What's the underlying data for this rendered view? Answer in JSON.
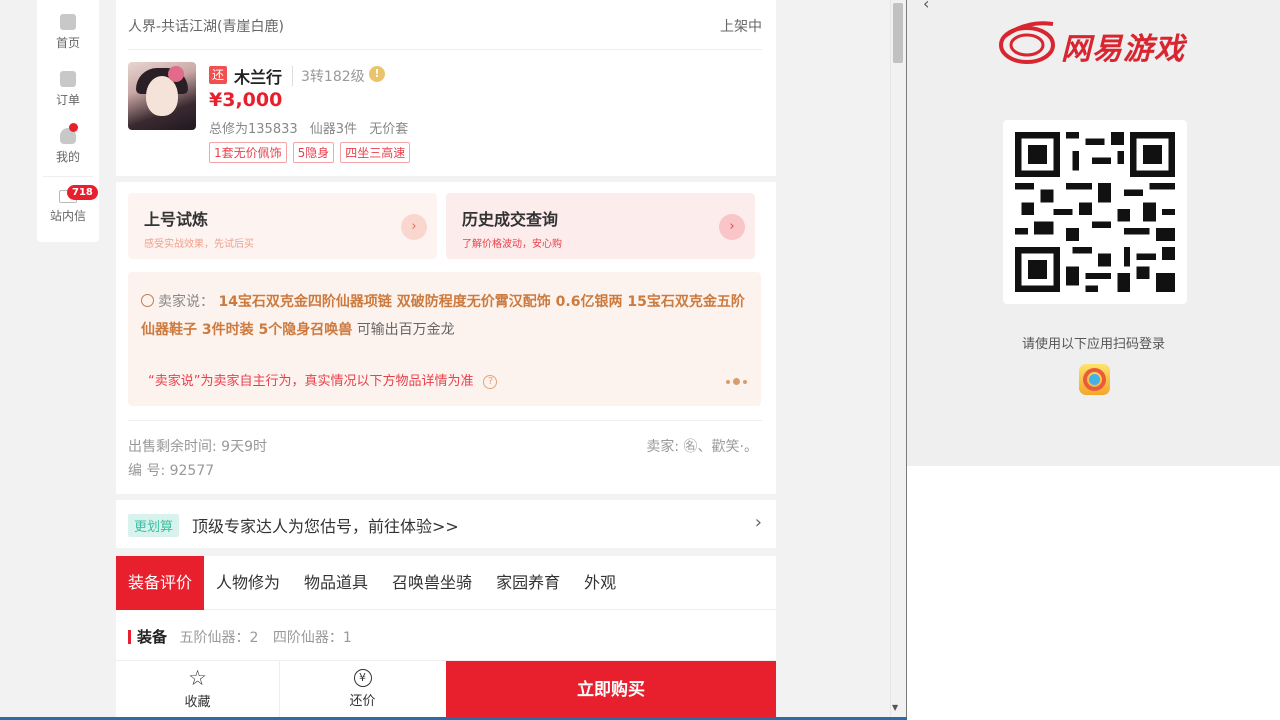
{
  "sidenav": {
    "items": [
      {
        "label": "首页",
        "icon": "home-icon"
      },
      {
        "label": "订单",
        "icon": "order-icon"
      },
      {
        "label": "我的",
        "icon": "user-icon"
      },
      {
        "label": "站内信",
        "icon": "mail-icon"
      }
    ],
    "message_count": "718"
  },
  "listing": {
    "server": "人界-共话江湖(青崖白鹿)",
    "status": "上架中",
    "tag": "还",
    "name": "木兰行",
    "level": "3转182级",
    "price": "¥3,000",
    "attrs": [
      "总修为135833",
      "仙器3件",
      "无价套"
    ],
    "chips": [
      "1套无价佩饰",
      "5隐身",
      "四坐三高速"
    ]
  },
  "tiles": [
    {
      "title": "上号试炼",
      "subtitle": "感受实战效果，先试后买"
    },
    {
      "title": "历史成交查询",
      "subtitle": "了解价格波动，安心购"
    }
  ],
  "seller_says": {
    "label": "卖家说：",
    "highlight": "14宝石双克金四阶仙器项链 双破防程度无价霄汉配饰 0.6亿银两 15宝石双克金五阶仙器鞋子 3件时装 5个隐身召唤兽",
    "tail": "可输出百万金龙",
    "note": "“卖家说”为卖家自主行为，真实情况以下方物品详情为准"
  },
  "meta": {
    "remaining": "出售剩余时间: 9天9时",
    "serial": "编 号: 92577",
    "seller": "卖家: ㊔、歡笑·。"
  },
  "evaluation": {
    "tag": "更划算",
    "text": "顶级专家达人为您估号，前往体验>>"
  },
  "tabs": [
    "装备评价",
    "人物修为",
    "物品道具",
    "召唤兽坐骑",
    "家园养育",
    "外观"
  ],
  "equip_section": {
    "title": "装备",
    "tiers": [
      "五阶仙器：2",
      "四阶仙器：1"
    ]
  },
  "bottom": {
    "favorite": "收藏",
    "bargain": "还价",
    "buy": "立即购买"
  },
  "login_panel": {
    "brand": "网易游戏",
    "hint": "请使用以下应用扫码登录"
  },
  "colors": {
    "accent": "#e8202e",
    "brand": "#d9252f",
    "seller_highlight": "#cc7a3e"
  }
}
